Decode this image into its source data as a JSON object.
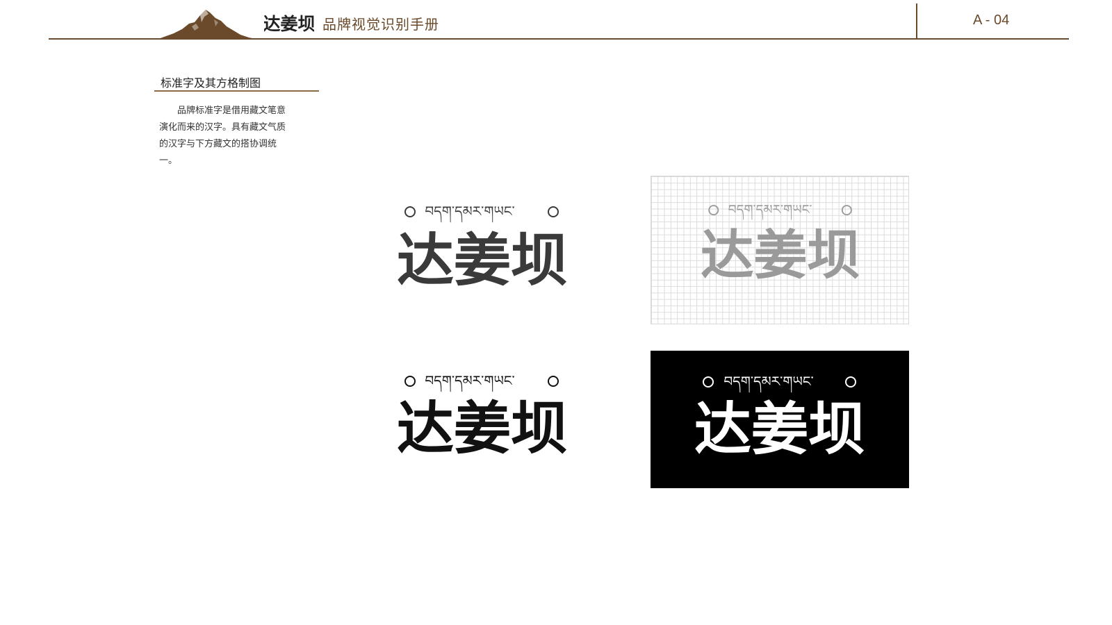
{
  "header": {
    "brand_logo_text": "达姜坝",
    "manual_title": "品牌视觉识别手册",
    "page_number": "A - 04"
  },
  "section": {
    "title": "标准字及其方格制图",
    "body": "品牌标准字是借用藏文笔意演化而来的汉字。具有藏文气质的汉字与下方藏文的搭协调统一。"
  },
  "logos": {
    "tibetan_line": "བདག་དམར་གཡང་",
    "chinese_wordmark": "达姜坝",
    "colors": {
      "dark_gray": "#3a3a3a",
      "light_gray": "#9a9a9a",
      "black": "#111111",
      "white": "#ffffff",
      "brand_brown": "#6b4a2b"
    }
  }
}
